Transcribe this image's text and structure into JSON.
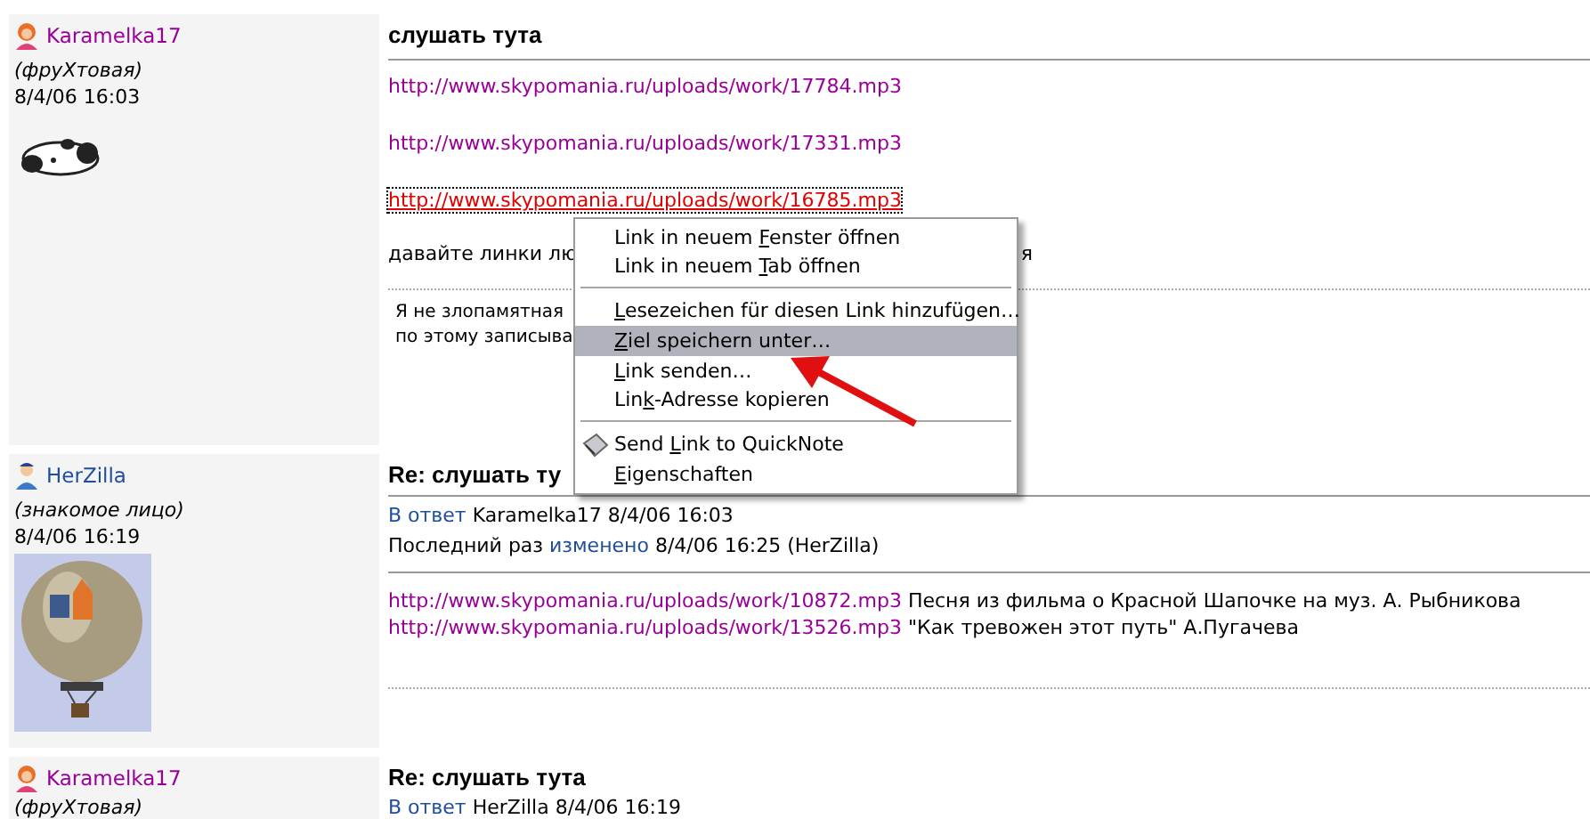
{
  "posts": [
    {
      "kind": "panda",
      "author": "Karamelka17",
      "color": "#990099",
      "role": "(фруХтовая)",
      "date": "8/4/06 16:03",
      "title": "слушать тута",
      "links": [
        {
          "url": "http://www.skypomania.ru/uploads/work/17784.mp3",
          "hovered": false
        },
        {
          "url": "http://www.skypomania.ru/uploads/work/17331.mp3",
          "hovered": false
        },
        {
          "url": "http://www.skypomania.ru/uploads/work/16785.mp3",
          "hovered": true
        }
      ],
      "text": [
        "давайте линки лю",
        "я"
      ],
      "signature": [
        "Я не злопамятная",
        "по этому записыва"
      ]
    },
    {
      "author": "HerZilla",
      "color": "#1f4e9a",
      "role": "(знакомое лицо)",
      "date": "8/4/06 16:19",
      "title": "Re: слушать ту",
      "meta": [
        [
          {
            "link": "В ответ"
          },
          {
            "text": " Karamelka17 8/4/06 16:03"
          }
        ],
        [
          {
            "text": "Последний раз "
          },
          {
            "link": "изменено"
          },
          {
            "text": " 8/4/06 16:25 (HerZilla)"
          }
        ]
      ],
      "links": [
        {
          "url": "http://www.skypomania.ru/uploads/work/10872.mp3",
          "caption": " Песня из фильма о Красной Шапочке на муз. А. Рыбникова",
          "hovered": false
        },
        {
          "url": "http://www.skypomania.ru/uploads/work/13526.mp3",
          "caption": " \"Как тревожен этот путь\" А.Пугачева",
          "hovered": false
        }
      ]
    },
    {
      "kind": "plain",
      "author": "Karamelka17",
      "color": "#990099",
      "role": "(фруХтовая)",
      "title": "Re: слушать тута",
      "meta": [
        [
          {
            "link": "В ответ"
          },
          {
            "text": " HerZilla 8/4/06 16:19"
          }
        ]
      ]
    }
  ],
  "context_menu": {
    "items": [
      {
        "kind": "plain",
        "pre": "Link in neuem ",
        "key": "F",
        "post": "enster öffnen",
        "selected": false,
        "separator_after": false
      },
      {
        "kind": "plain",
        "pre": "Link in neuem ",
        "key": "T",
        "post": "ab öffnen",
        "selected": false,
        "separator_after": true
      },
      {
        "kind": "plain",
        "key": "L",
        "post": "esezeichen für diesen Link hinzufügen…",
        "selected": false,
        "separator_after": false
      },
      {
        "kind": "plain",
        "key": "Z",
        "post": "iel speichern unter…",
        "selected": true,
        "separator_after": false
      },
      {
        "kind": "plain",
        "key": "L",
        "post": "ink senden…",
        "selected": false,
        "separator_after": false
      },
      {
        "kind": "plain",
        "pre": "Lin",
        "key": "k",
        "post": "-Adresse kopieren",
        "selected": false,
        "separator_after": true
      },
      {
        "kind": "addon",
        "pre": "Send ",
        "key": "L",
        "post": "ink to QuickNote",
        "selected": false,
        "separator_after": false
      },
      {
        "kind": "plain",
        "key": "E",
        "post": "igenschaften",
        "selected": false,
        "separator_after": false
      }
    ]
  }
}
